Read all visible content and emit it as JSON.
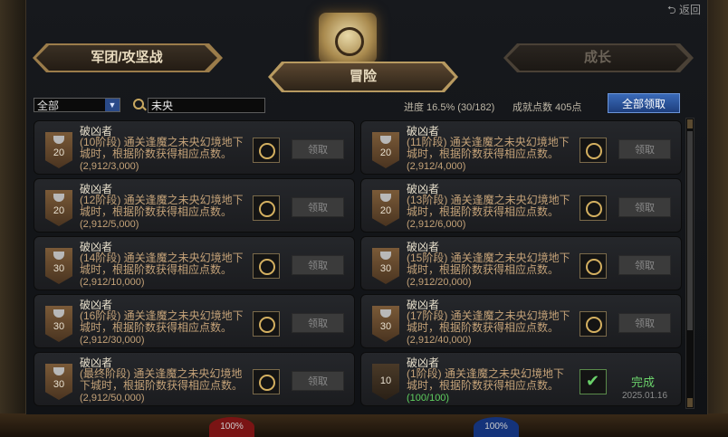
{
  "header": {
    "back_label": "返回",
    "tabs": [
      {
        "label": "军团/攻坚战",
        "state": "inactive"
      },
      {
        "label": "冒险",
        "state": "active"
      },
      {
        "label": "成长",
        "state": "disabled"
      }
    ]
  },
  "filter": {
    "selected": "全部",
    "search_value": "未央"
  },
  "summary": {
    "progress_text": "进度 16.5% (30/182)",
    "points_text": "成就点数 405点",
    "claim_all_label": "全部领取"
  },
  "achievements": [
    {
      "level": "20",
      "title": "破凶者",
      "desc": "(10阶段) 通关逢魔之未央幻境地下城时，根据阶数获得相应点数。",
      "count": "(2,912/3,000)",
      "action": "领取"
    },
    {
      "level": "20",
      "title": "破凶者",
      "desc": "(11阶段) 通关逢魔之未央幻境地下城时，根据阶数获得相应点数。",
      "count": "(2,912/4,000)",
      "action": "领取"
    },
    {
      "level": "20",
      "title": "破凶者",
      "desc": "(12阶段) 通关逢魔之未央幻境地下城时，根据阶数获得相应点数。",
      "count": "(2,912/5,000)",
      "action": "领取"
    },
    {
      "level": "20",
      "title": "破凶者",
      "desc": "(13阶段) 通关逢魔之未央幻境地下城时，根据阶数获得相应点数。",
      "count": "(2,912/6,000)",
      "action": "领取"
    },
    {
      "level": "30",
      "title": "破凶者",
      "desc": "(14阶段) 通关逢魔之未央幻境地下城时，根据阶数获得相应点数。",
      "count": "(2,912/10,000)",
      "action": "领取"
    },
    {
      "level": "30",
      "title": "破凶者",
      "desc": "(15阶段) 通关逢魔之未央幻境地下城时，根据阶数获得相应点数。",
      "count": "(2,912/20,000)",
      "action": "领取"
    },
    {
      "level": "30",
      "title": "破凶者",
      "desc": "(16阶段) 通关逢魔之未央幻境地下城时，根据阶数获得相应点数。",
      "count": "(2,912/30,000)",
      "action": "领取"
    },
    {
      "level": "30",
      "title": "破凶者",
      "desc": "(17阶段) 通关逢魔之未央幻境地下城时，根据阶数获得相应点数。",
      "count": "(2,912/40,000)",
      "action": "领取"
    },
    {
      "level": "30",
      "title": "破凶者",
      "desc": "(最终阶段) 通关逢魔之未央幻境地下城时，根据阶数获得相应点数。",
      "count": "(2,912/50,000)",
      "action": "领取"
    },
    {
      "level": "10",
      "title": "破凶者",
      "desc": "(1阶段) 通关逢魔之未央幻境地下城时，根据阶数获得相应点数。",
      "count": "(100/100)",
      "status": "完成",
      "date": "2025.01.16"
    }
  ],
  "hud": {
    "hp": "100%",
    "mp": "100%"
  }
}
